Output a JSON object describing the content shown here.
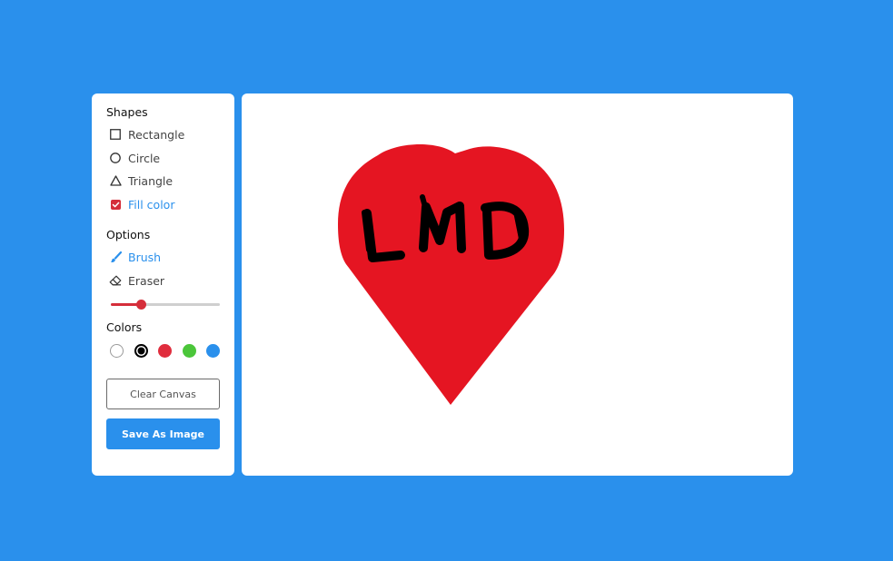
{
  "tools_panel": {
    "shapes_title": "Shapes",
    "shapes": [
      {
        "label": "Rectangle",
        "icon": "square-outline-icon"
      },
      {
        "label": "Circle",
        "icon": "circle-outline-icon"
      },
      {
        "label": "Triangle",
        "icon": "triangle-outline-icon"
      }
    ],
    "fill_color": {
      "label": "Fill color",
      "checked": true
    },
    "options_title": "Options",
    "options": [
      {
        "label": "Brush",
        "icon": "brush-icon",
        "active": true
      },
      {
        "label": "Eraser",
        "icon": "eraser-icon",
        "active": false
      }
    ],
    "brush_size": {
      "min": 1,
      "max": 30,
      "value": 9
    },
    "colors_title": "Colors",
    "colors": [
      {
        "name": "white",
        "hex": "#ffffff",
        "selected": false
      },
      {
        "name": "black",
        "hex": "#000000",
        "selected": true
      },
      {
        "name": "red",
        "hex": "#e02d3d",
        "selected": false
      },
      {
        "name": "green",
        "hex": "#4bc63a",
        "selected": false
      },
      {
        "name": "blue",
        "hex": "#2a90ec",
        "selected": false
      }
    ],
    "clear_label": "Clear Canvas",
    "save_label": "Save As Image"
  },
  "canvas": {
    "heart_color": "#e51522",
    "ink_color": "#000000",
    "text": "LMD"
  },
  "theme": {
    "background": "#2a90ec",
    "accent": "#2a90ec",
    "slider_color": "#d52e3a"
  }
}
